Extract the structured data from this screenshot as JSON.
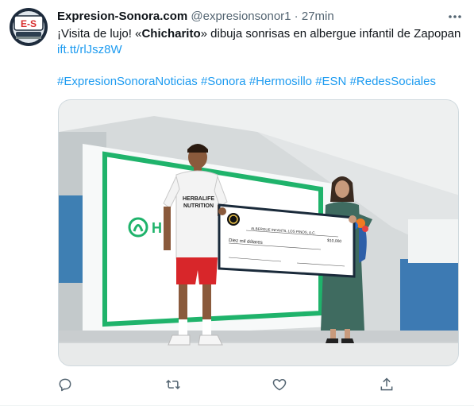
{
  "tweet": {
    "author_name": "Expresion-Sonora.com",
    "author_handle": "@expresionsonor1",
    "separator": " · ",
    "time": "27min",
    "text_part1": "¡Visita de lujo! «",
    "text_bold": "Chicharito",
    "text_part2": "» dibuja sonrisas en albergue infantil de Zapopan ",
    "link": "ift.tt/rlJsz8W",
    "hashtags": [
      "#ExpresionSonoraNoticias",
      "#Sonora",
      "#Hermosillo",
      "#ESN",
      "#RedesSociales"
    ]
  },
  "avatar": {
    "text": "E-S"
  },
  "photo": {
    "jersey_text_1": "HERBALIFE",
    "jersey_text_2": "NUTRITION",
    "screen_logo_text": "H",
    "check_payee": "ALBERGUE INFANTIL LOS PINOS, A.C.",
    "check_amount": "$10,000",
    "check_words": "Diez mil dólares"
  },
  "icons": {
    "reply": "reply-icon",
    "retweet": "retweet-icon",
    "like": "like-icon",
    "share": "share-icon",
    "more": "more-icon"
  },
  "colors": {
    "link": "#1d9bf0",
    "meta": "#536471",
    "screen_green": "#1fb36b",
    "text": "#0f1419"
  }
}
